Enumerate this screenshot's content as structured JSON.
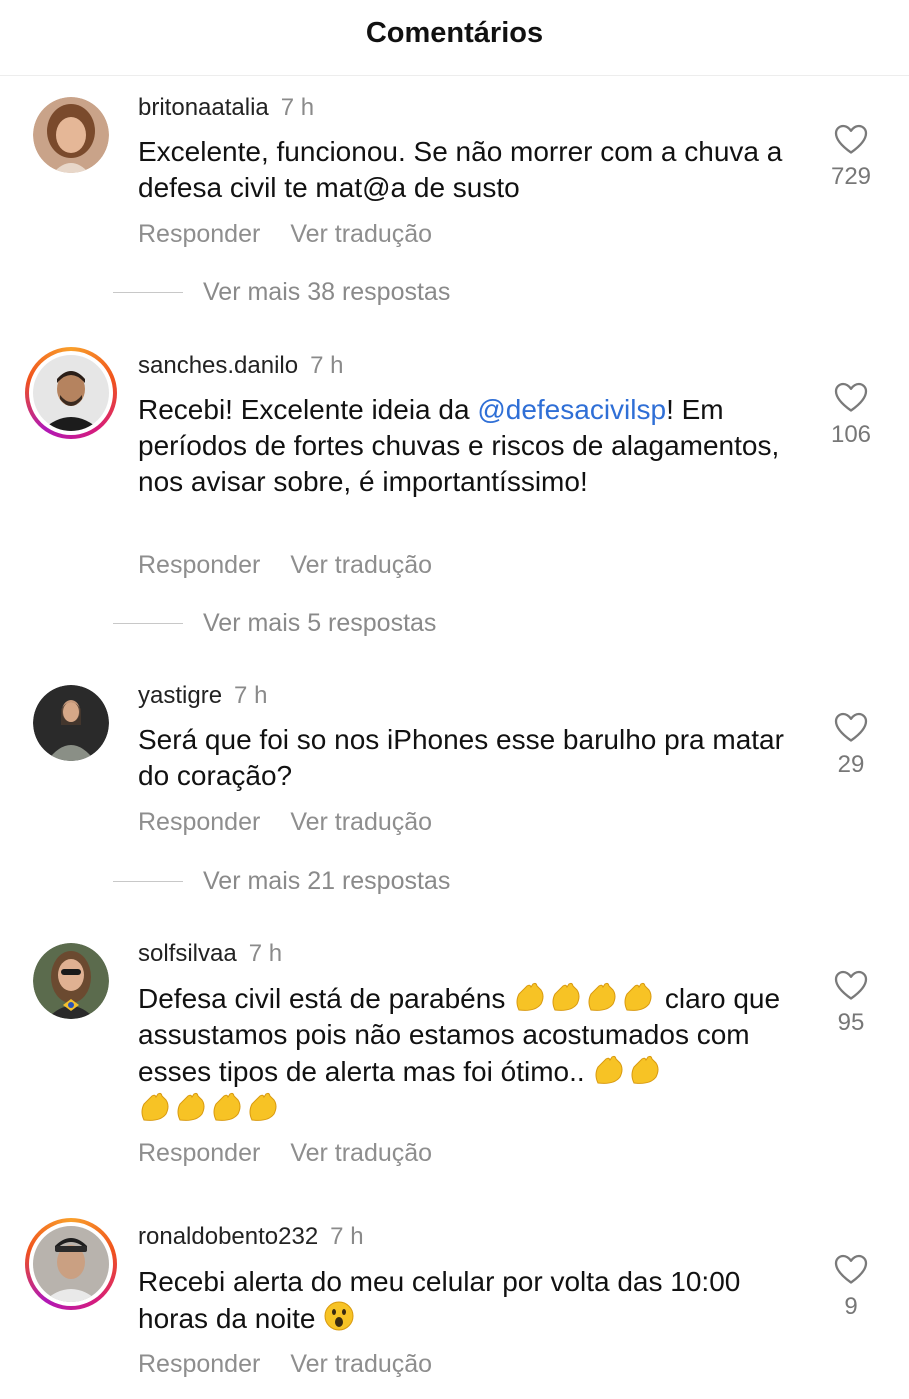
{
  "header": {
    "title": "Comentários"
  },
  "comments": [
    {
      "username": "britonaatalia",
      "time": "7 h",
      "text": "Excelente, funcionou. Se não morrer com a chuva a defesa civil te mat@a de susto",
      "likes": "729",
      "reply_label": "Responder",
      "translate_label": "Ver tradução",
      "more_replies": "Ver mais 38 respostas"
    },
    {
      "username": "sanches.danilo",
      "time": "7 h",
      "text_before": "Recebi! Excelente ideia da ",
      "mention": "@defesacivilsp",
      "text_after": "! Em períodos de fortes chuvas e riscos de alagamentos, nos avisar sobre, é importantíssimo!",
      "likes": "106",
      "reply_label": "Responder",
      "translate_label": "Ver tradução",
      "more_replies": "Ver mais 5 respostas"
    },
    {
      "username": "yastigre",
      "time": "7 h",
      "text": "Será que foi so nos iPhones esse barulho pra matar do coração?",
      "likes": "29",
      "reply_label": "Responder",
      "translate_label": "Ver tradução",
      "more_replies": "Ver mais 21 respostas"
    },
    {
      "username": "solfsilvaa",
      "time": "7 h",
      "text_a": "Defesa civil está de parabéns ",
      "text_b": " claro que assustamos pois não estamos acostumados com esses tipos de alerta mas foi ótimo..",
      "likes": "95",
      "reply_label": "Responder",
      "translate_label": "Ver tradução"
    },
    {
      "username": "ronaldobento232",
      "time": "7 h",
      "text": "Recebi alerta do meu celular por volta das 10:00 horas da noite ",
      "likes": "9",
      "reply_label": "Responder",
      "translate_label": "Ver tradução"
    }
  ],
  "icons": {
    "like": "heart-outline-icon",
    "clap": "clapping-hands-emoji",
    "surprised": "surprised-face-emoji"
  },
  "colors": {
    "mention": "#2f6fd6",
    "muted": "#8e8e8e",
    "clap_emoji": "#f7c325",
    "story_ring": "#d61c7b"
  }
}
